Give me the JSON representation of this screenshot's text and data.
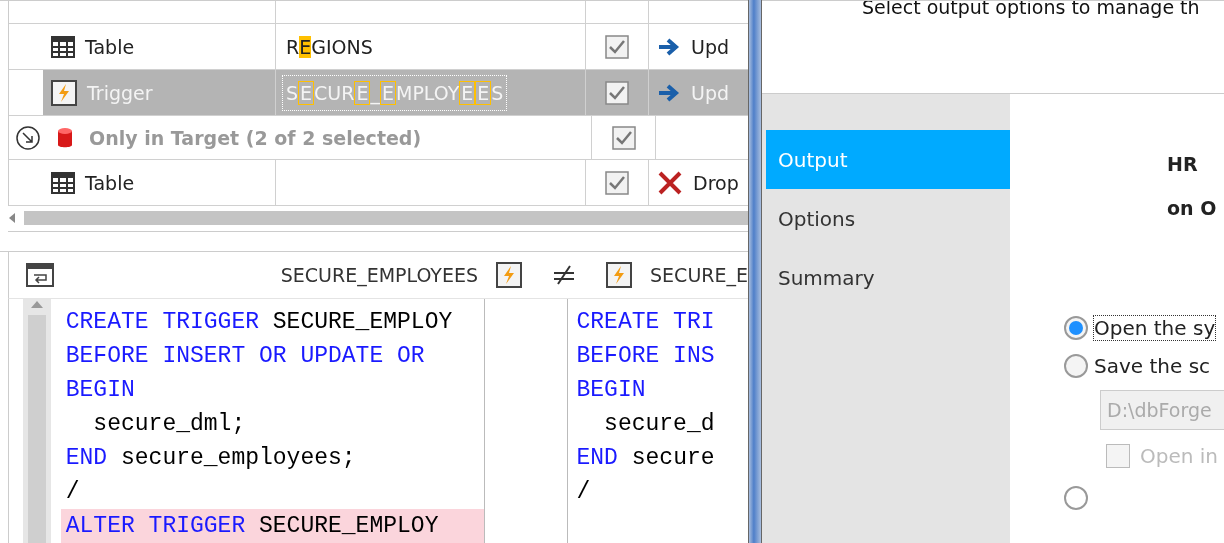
{
  "compare_grid": {
    "rows": [
      {
        "kind": "table",
        "type": "Table",
        "name": [
          {
            "text": "R",
            "match": false
          },
          {
            "text": "E",
            "match": true
          },
          {
            "text": "GIONS",
            "match": false
          }
        ],
        "checked": true,
        "action": {
          "text": "Upd",
          "kind": "update"
        },
        "selected": false
      },
      {
        "kind": "trigger",
        "type": "Trigger",
        "name": [
          {
            "text": "S",
            "match": false
          },
          {
            "text": "E",
            "match": true
          },
          {
            "text": "CUR",
            "match": false
          },
          {
            "text": "E",
            "match": true
          },
          {
            "text": "_",
            "match": false
          },
          {
            "text": "E",
            "match": true
          },
          {
            "text": "MPLOY",
            "match": false
          },
          {
            "text": "E",
            "match": true
          },
          {
            "text": "E",
            "match": true
          },
          {
            "text": "S",
            "match": false
          }
        ],
        "checked": true,
        "action": {
          "text": "Upd",
          "kind": "update"
        },
        "selected": true
      },
      {
        "kind": "group",
        "label": "Only in Target (2 of 2 selected)",
        "checked": true
      },
      {
        "kind": "table",
        "type": "Table",
        "name": [],
        "checked": true,
        "action": {
          "text": "Drop",
          "kind": "drop"
        },
        "selected": false
      }
    ]
  },
  "diff_header": {
    "left_title": "SECURE_EMPLOYEES",
    "right_title": "SECURE_E"
  },
  "code_left": [
    {
      "diff": false,
      "tokens": [
        {
          "t": "CREATE TRIGGER",
          "kind": "keyword"
        },
        {
          "t": " SECURE_EMPLOY",
          "kind": "ident"
        }
      ]
    },
    {
      "diff": false,
      "tokens": [
        {
          "t": "BEFORE INSERT OR UPDATE OR",
          "kind": "keyword"
        }
      ]
    },
    {
      "diff": false,
      "tokens": [
        {
          "t": "BEGIN",
          "kind": "keyword"
        }
      ]
    },
    {
      "diff": false,
      "tokens": [
        {
          "t": "  secure_dml;",
          "kind": "ident"
        }
      ]
    },
    {
      "diff": false,
      "tokens": [
        {
          "t": "END",
          "kind": "keyword"
        },
        {
          "t": " secure_employees;",
          "kind": "ident"
        }
      ]
    },
    {
      "diff": false,
      "tokens": [
        {
          "t": "/",
          "kind": "ident"
        }
      ]
    },
    {
      "diff": true,
      "tokens": [
        {
          "t": "ALTER TRIGGER",
          "kind": "keyword"
        },
        {
          "t": " SECURE_EMPLOY",
          "kind": "ident"
        }
      ]
    }
  ],
  "code_right": [
    {
      "diff": false,
      "tokens": [
        {
          "t": "CREATE TRI",
          "kind": "keyword"
        }
      ]
    },
    {
      "diff": false,
      "tokens": [
        {
          "t": "BEFORE INS",
          "kind": "keyword"
        }
      ]
    },
    {
      "diff": false,
      "tokens": [
        {
          "t": "BEGIN",
          "kind": "keyword"
        }
      ]
    },
    {
      "diff": false,
      "tokens": [
        {
          "t": "  secure_d",
          "kind": "ident"
        }
      ]
    },
    {
      "diff": false,
      "tokens": [
        {
          "t": "END",
          "kind": "keyword"
        },
        {
          "t": " secure",
          "kind": "ident"
        }
      ]
    },
    {
      "diff": false,
      "tokens": [
        {
          "t": "/",
          "kind": "ident"
        }
      ]
    }
  ],
  "dialog": {
    "description": "Select output options to manage th",
    "sidebar": {
      "items": [
        {
          "label": "Output",
          "selected": true
        },
        {
          "label": "Options",
          "selected": false
        },
        {
          "label": "Summary",
          "selected": false
        }
      ]
    },
    "heading": [
      "HR",
      "on O"
    ],
    "radios": [
      {
        "label": "Open the sy",
        "selected": true
      },
      {
        "label": "Save the sc",
        "selected": false
      }
    ],
    "path_field": {
      "value": "D:\\dbForge",
      "disabled": true
    },
    "open_checkbox": {
      "label": "Open in",
      "checked": false,
      "disabled": true
    },
    "radio_partial": {
      "selected": false
    }
  }
}
